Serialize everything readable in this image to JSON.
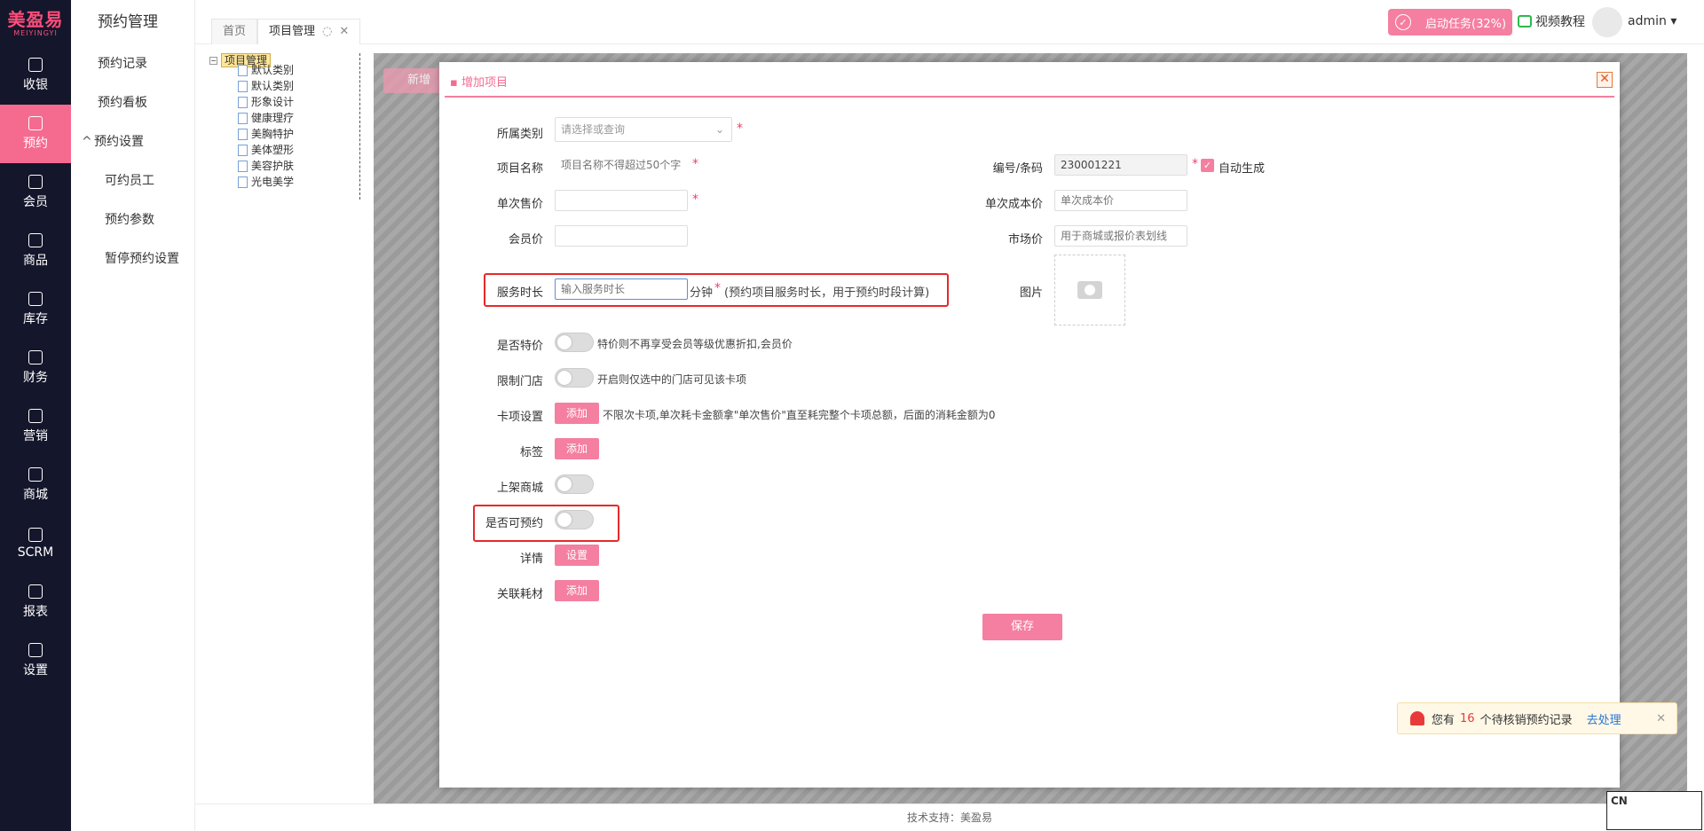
{
  "brand": {
    "logo_cn": "美盈易",
    "logo_en": "MEIYINGYI",
    "accent": "#f56b90"
  },
  "leftnav": [
    {
      "label": "收银",
      "icon": "cashier-icon"
    },
    {
      "label": "预约",
      "icon": "clock-icon",
      "active": true
    },
    {
      "label": "会员",
      "icon": "member-icon"
    },
    {
      "label": "商品",
      "icon": "bag-icon"
    },
    {
      "label": "库存",
      "icon": "warehouse-icon"
    },
    {
      "label": "财务",
      "icon": "money-icon"
    },
    {
      "label": "营销",
      "icon": "megaphone-icon"
    },
    {
      "label": "商城",
      "icon": "shop-icon"
    },
    {
      "label": "SCRM",
      "icon": "scrm-icon"
    },
    {
      "label": "报表",
      "icon": "report-icon"
    },
    {
      "label": "设置",
      "icon": "settings-icon"
    }
  ],
  "submenu": {
    "title": "预约管理",
    "items": [
      "预约记录",
      "预约看板",
      "预约设置",
      "可约员工",
      "预约参数",
      "暂停预约设置"
    ]
  },
  "tabs": [
    "首页",
    "项目管理"
  ],
  "topbar": {
    "task": "启动任务(32%)",
    "video": "视频教程",
    "user": "admin"
  },
  "tree": {
    "root": "项目管理",
    "nodes": [
      "默认类别",
      "默认类别",
      "形象设计",
      "健康理疗",
      "美胸特护",
      "美体塑形",
      "美容护肤",
      "光电美学"
    ]
  },
  "bg": {
    "add_btn": "新增"
  },
  "modal": {
    "title": "增加项目",
    "fields": {
      "category_label": "所属类别",
      "category_placeholder": "请选择或查询",
      "name_label": "项目名称",
      "name_placeholder": "项目名称不得超过50个字",
      "code_label": "编号/条码",
      "code_value": "230001221",
      "auto_label": "自动生成",
      "price_label": "单次售价",
      "cost_label": "单次成本价",
      "cost_placeholder": "单次成本价",
      "member_label": "会员价",
      "market_label": "市场价",
      "market_placeholder": "用于商城或报价表划线",
      "duration_label": "服务时长",
      "duration_placeholder": "输入服务时长",
      "duration_unit": "分钟",
      "duration_hint": "(预约项目服务时长，用于预约时段计算)",
      "image_label": "图片",
      "special_label": "是否特价",
      "special_hint": "特价则不再享受会员等级优惠折扣,会员价",
      "store_label": "限制门店",
      "store_hint": "开启则仅选中的门店可见该卡项",
      "card_label": "卡项设置",
      "card_btn": "添加",
      "card_hint": "不限次卡项,单次耗卡金额拿\"单次售价\"直至耗完整个卡项总额，后面的消耗金额为0",
      "tag_label": "标签",
      "tag_btn": "添加",
      "mall_label": "上架商城",
      "bookable_label": "是否可预约",
      "detail_label": "详情",
      "detail_btn": "设置",
      "material_label": "关联耗材",
      "material_btn": "添加"
    },
    "save": "保存"
  },
  "notice": {
    "pre": "您有",
    "count": "16",
    "post": "个待核销预约记录",
    "action": "去处理"
  },
  "footer": "技术支持：美盈易",
  "cn_badge": "CN"
}
